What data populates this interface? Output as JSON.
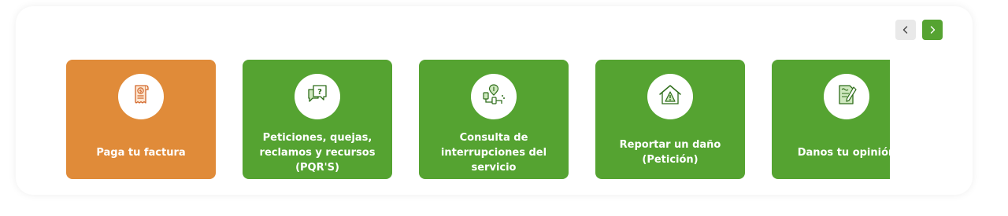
{
  "carousel": {
    "prev_icon": "chevron-left-icon",
    "next_icon": "chevron-right-icon",
    "cards": [
      {
        "label": "Paga tu factura",
        "icon": "bill-icon",
        "color": "#e08b39"
      },
      {
        "label": "Peticiones, quejas, reclamos y recursos (PQR'S)",
        "icon": "question-chat-icon",
        "color": "#55a331"
      },
      {
        "label": "Consulta de interrupciones del servicio",
        "icon": "pipe-interruption-icon",
        "color": "#55a331"
      },
      {
        "label": "Reportar un daño (Petición)",
        "icon": "house-warning-icon",
        "color": "#55a331"
      },
      {
        "label": "Danos tu opinión",
        "icon": "document-pen-icon",
        "color": "#55a331"
      }
    ]
  },
  "colors": {
    "accent_green": "#55a331",
    "accent_orange": "#e08b39",
    "nav_inactive": "#e9e9e9"
  }
}
